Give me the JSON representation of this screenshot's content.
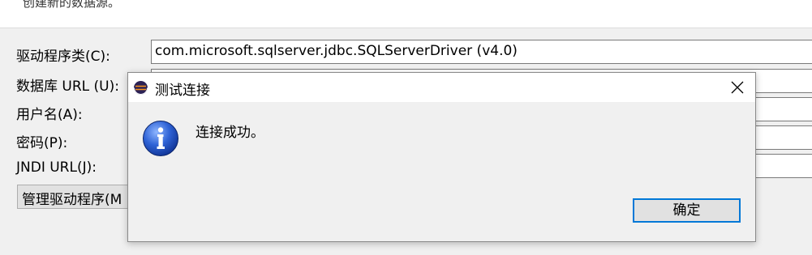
{
  "banner": {
    "text": "创建新的数据源。"
  },
  "form": {
    "driver_class": {
      "label": "驱动程序类(C):",
      "value": "com.microsoft.sqlserver.jdbc.SQLServerDriver (v4.0)"
    },
    "db_url": {
      "label": "数据库 URL (U):",
      "value": ""
    },
    "username": {
      "label": "用户名(A):",
      "value": ""
    },
    "password": {
      "label": "密码(P):",
      "value": ""
    },
    "jndi_url": {
      "label": "JNDI URL(J):",
      "value": ""
    },
    "manage_drivers_label": "管理驱动程序(M"
  },
  "dialog": {
    "title": "测试连接",
    "message": "连接成功。",
    "ok_label": "确定",
    "title_icon": "eclipse-icon",
    "message_icon": "info-icon",
    "accent_color": "#0078d7"
  }
}
